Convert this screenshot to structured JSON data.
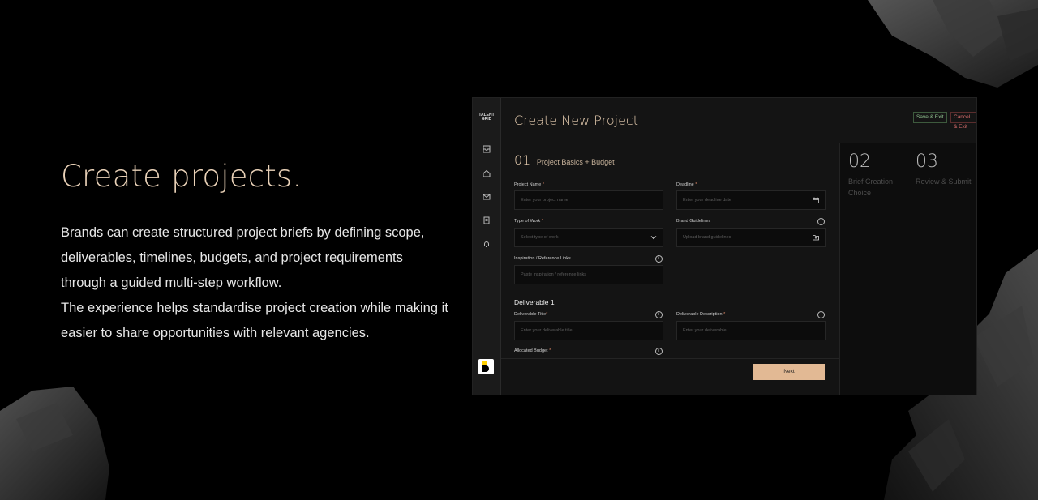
{
  "hero": {
    "title": "Create projects.",
    "desc_line1": "Brands can create structured project briefs by defining scope, deliverables, timelines, budgets, and project requirements through a guided multi-step workflow.",
    "desc_line2": "The experience helps standardise project creation while making it easier to share opportunities with relevant agencies."
  },
  "app": {
    "logo_line1": "TALENT",
    "logo_line2": "GRID",
    "page_title": "Create New Project",
    "save_label": "Save & Exit",
    "cancel_label": "Cancel & Exit",
    "sidebar_icons": [
      "inbox-icon",
      "home-icon",
      "mail-icon",
      "document-icon",
      "bell-icon"
    ]
  },
  "form": {
    "step_number": "01",
    "step_title": "Project Basics + Budget",
    "project_name": {
      "label": "Project Name",
      "req": "*",
      "placeholder": "Enter your project name"
    },
    "deadline": {
      "label": "Deadline",
      "req": "*",
      "placeholder": "Enter your deadline date"
    },
    "type_of_work": {
      "label": "Type of Work",
      "req": "*",
      "placeholder": "Select type of work"
    },
    "brand_guidelines": {
      "label": "Brand Guidelines",
      "placeholder": "Upload brand guidelines"
    },
    "inspiration": {
      "label": "Inspiration / Reference Links",
      "placeholder": "Paste inspiration / reference links"
    },
    "deliverable_section": "Deliverable 1",
    "deliverable_title": {
      "label": "Deliverable Title",
      "req": "*",
      "placeholder": "Enter your deliverable title"
    },
    "deliverable_description": {
      "label": "Deliverable Description",
      "req": "*",
      "placeholder": "Enter your deliverable"
    },
    "allocated_budget": {
      "label": "Allocated Budget",
      "req": "*"
    },
    "next_label": "Next",
    "info_glyph": "i"
  },
  "steps": [
    {
      "number": "02",
      "title": "Brief Creation Choice"
    },
    {
      "number": "03",
      "title": "Review & Submit"
    }
  ],
  "colors": {
    "accent": "#e9cfb2",
    "next_button": "#e2b994",
    "save_text": "#8fc08f",
    "cancel_text": "#e07070",
    "background": "#000000"
  }
}
